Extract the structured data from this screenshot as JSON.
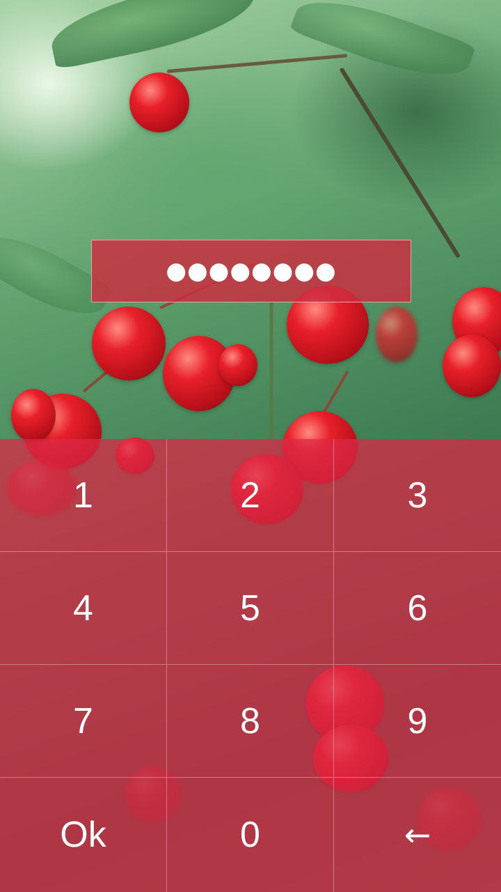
{
  "pin": {
    "masked_value": "●●●●●●●●"
  },
  "keypad": {
    "keys": [
      {
        "label": "1"
      },
      {
        "label": "2"
      },
      {
        "label": "3"
      },
      {
        "label": "4"
      },
      {
        "label": "5"
      },
      {
        "label": "6"
      },
      {
        "label": "7"
      },
      {
        "label": "8"
      },
      {
        "label": "9"
      },
      {
        "label": "Ok"
      },
      {
        "label": "0"
      },
      {
        "label": "←",
        "icon": "backspace-arrow-icon"
      }
    ]
  },
  "colors": {
    "accent": "#dc2846",
    "text": "#ffffff"
  }
}
